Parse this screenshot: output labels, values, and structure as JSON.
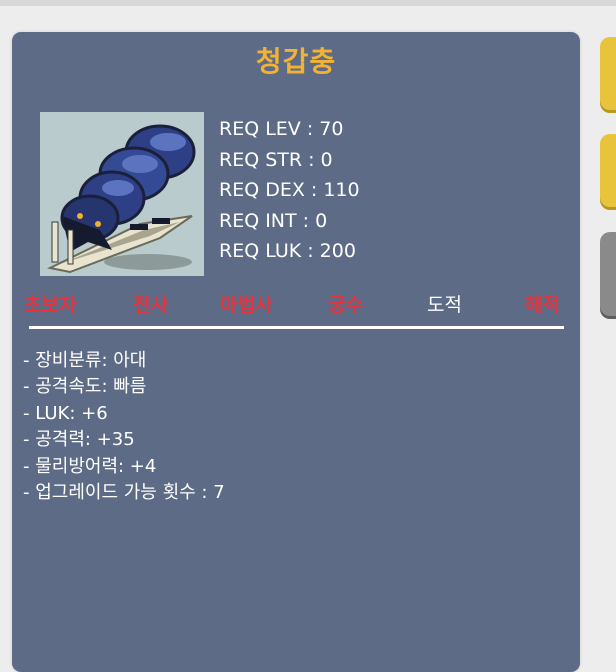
{
  "item": {
    "name": "청갑충",
    "image_icon": "armored-beetle-icon"
  },
  "requirements": {
    "lev": "REQ LEV : 70",
    "str": "REQ STR : 0",
    "dex": "REQ DEX : 110",
    "int": "REQ INT : 0",
    "luk": "REQ LUK : 200"
  },
  "jobs": [
    {
      "label": "초보자",
      "allowed": false
    },
    {
      "label": "전사",
      "allowed": false
    },
    {
      "label": "마법사",
      "allowed": false
    },
    {
      "label": "궁수",
      "allowed": false
    },
    {
      "label": "도적",
      "allowed": true
    },
    {
      "label": "해적",
      "allowed": false
    }
  ],
  "stats": [
    "- 장비분류: 아대",
    "- 공격속도: 빠름",
    "- LUK: +6",
    "- 공격력: +35",
    "- 물리방어력: +4",
    "- 업그레이드 가능 횟수 : 7"
  ],
  "colors": {
    "title": "#f3b234",
    "panel": "#5d6b86",
    "job_allowed": "#ffffff",
    "job_disallowed": "#e8323c"
  }
}
